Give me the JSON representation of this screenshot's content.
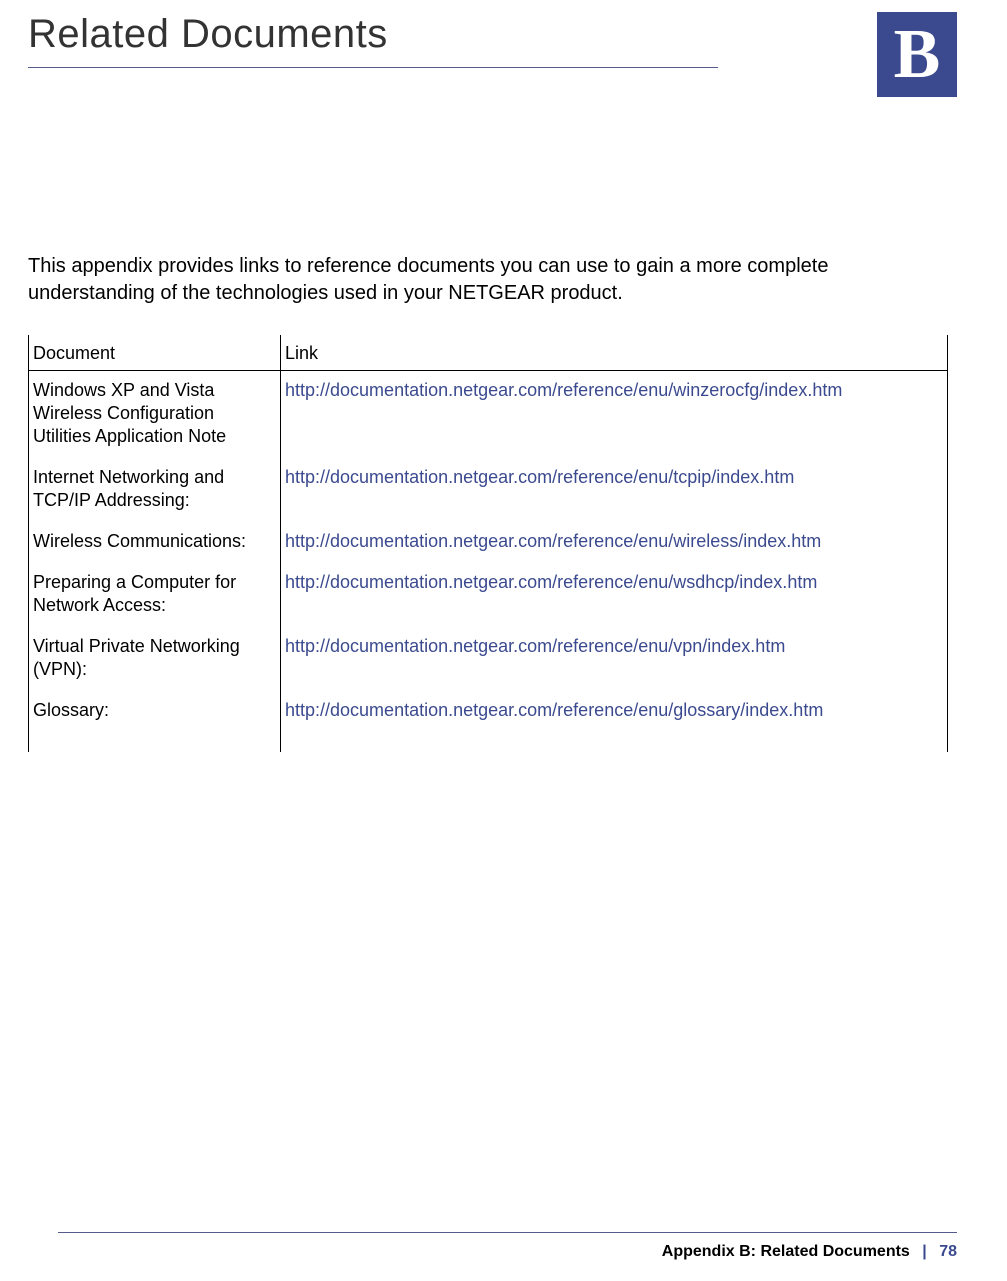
{
  "page": {
    "title": "Related Documents",
    "appendix_letter": "B",
    "intro": "This appendix provides links to reference documents you can use to gain a more complete understanding of the technologies used in your NETGEAR product."
  },
  "table": {
    "headers": {
      "document": "Document",
      "link": "Link"
    },
    "rows": [
      {
        "document": "Windows XP and Vista Wireless Configuration Utilities Application Note",
        "link": "http://documentation.netgear.com/reference/enu/winzerocfg/index.htm"
      },
      {
        "document": "Internet Networking and TCP/IP Addressing:",
        "link": "http://documentation.netgear.com/reference/enu/tcpip/index.htm"
      },
      {
        "document": "Wireless Communications:",
        "link": "http://documentation.netgear.com/reference/enu/wireless/index.htm"
      },
      {
        "document": "Preparing a Computer for Network Access:",
        "link": "http://documentation.netgear.com/reference/enu/wsdhcp/index.htm"
      },
      {
        "document": "Virtual Private Networking (VPN):",
        "link": "http://documentation.netgear.com/reference/enu/vpn/index.htm"
      },
      {
        "document": "Glossary:",
        "link": "http://documentation.netgear.com/reference/enu/glossary/index.htm"
      }
    ]
  },
  "footer": {
    "label": "Appendix B:  Related Documents",
    "separator": "|",
    "page_number": "78"
  }
}
